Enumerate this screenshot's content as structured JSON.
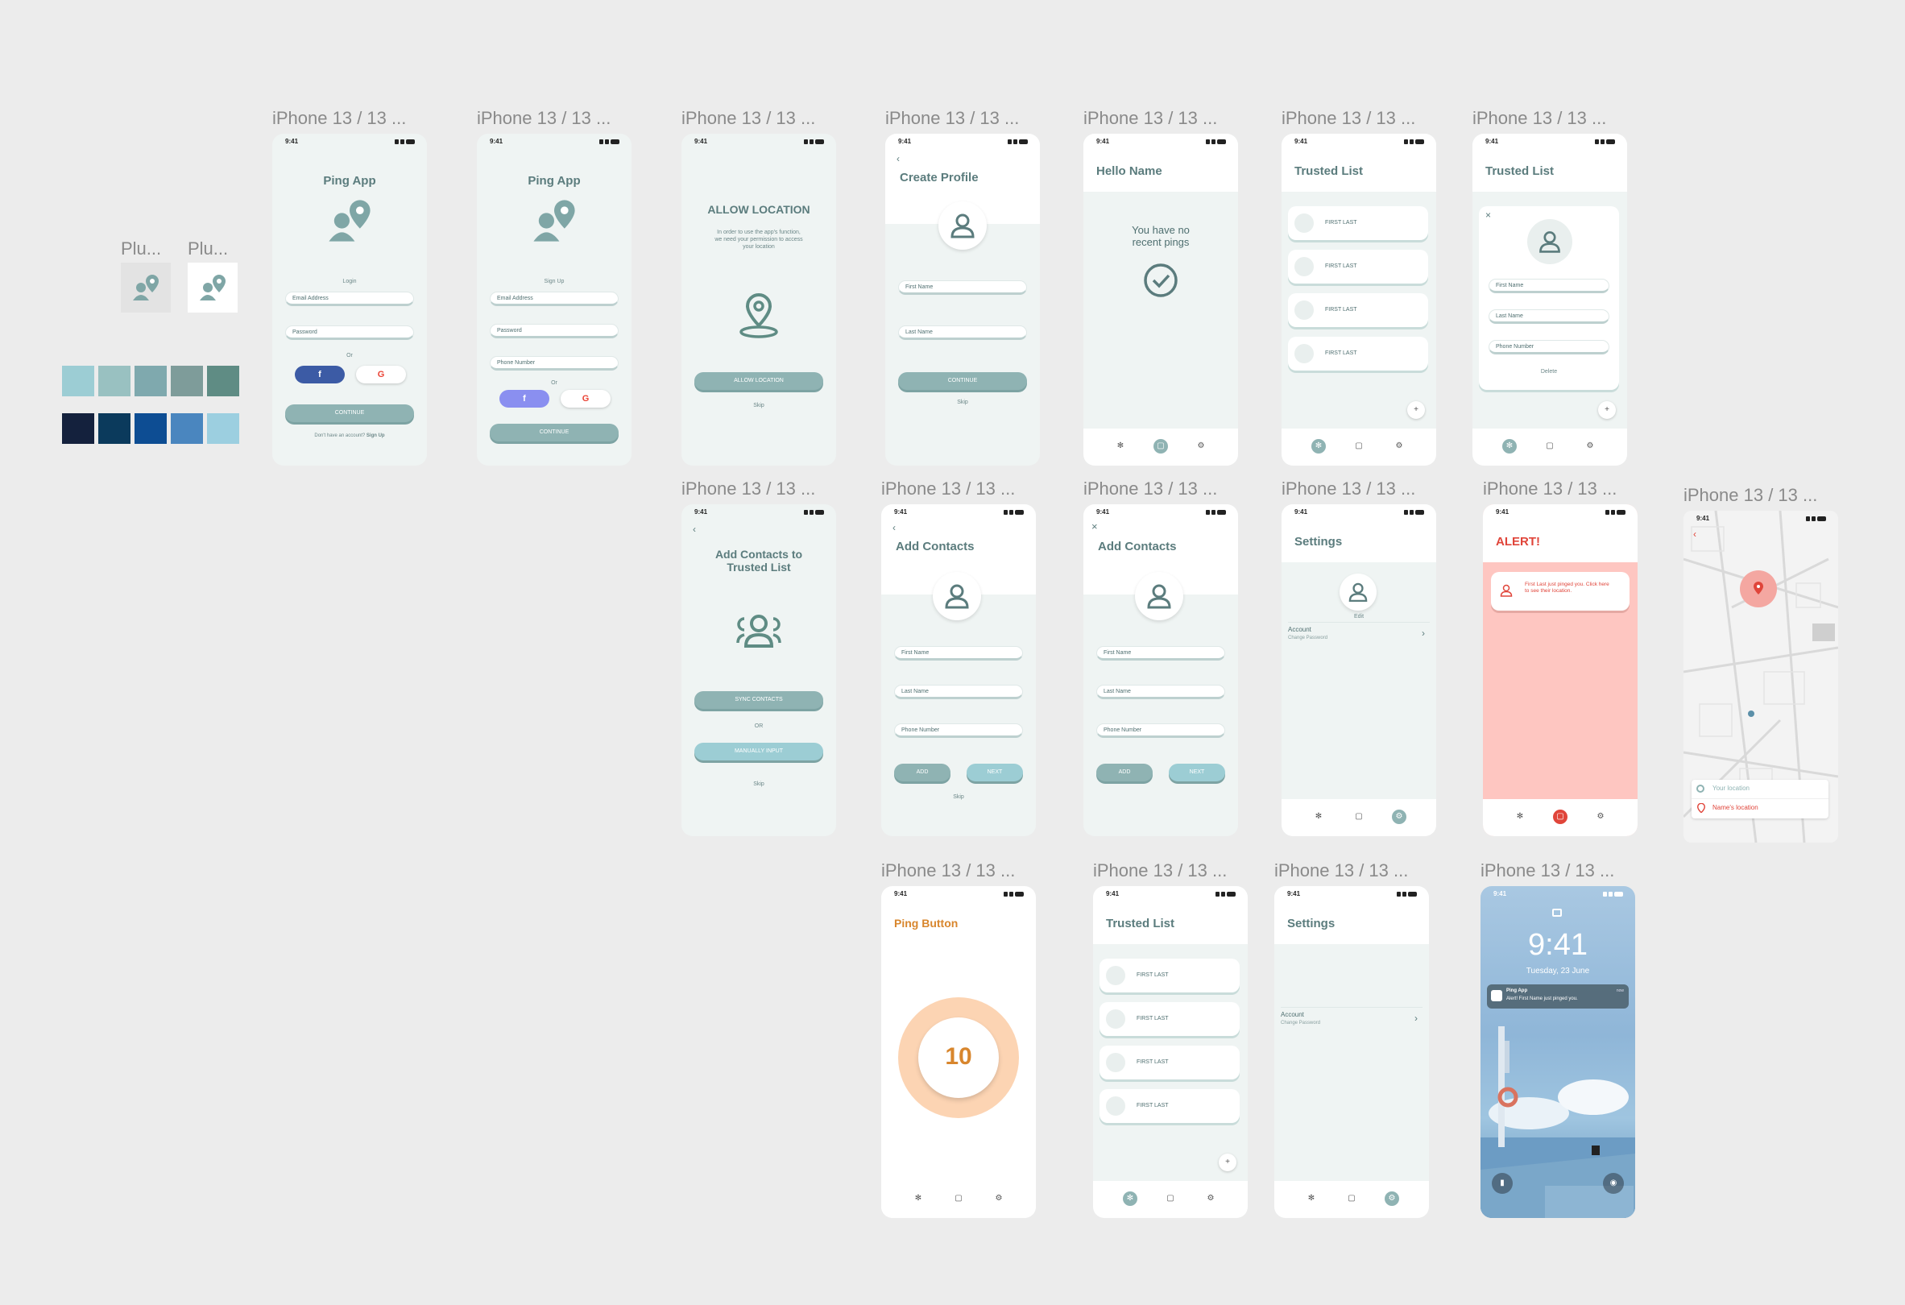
{
  "frame_label": "iPhone 13 / 13 ...",
  "plugin_label": "Plu...",
  "status_time": "9:41",
  "colors": {
    "palette_row1": [
      "#9ccdd4",
      "#99c1c1",
      "#7fa9ae",
      "#7e9c9a",
      "#5f8c84"
    ],
    "palette_row2": [
      "#14213d",
      "#0b3a5c",
      "#0d4d93",
      "#4a86bf",
      "#9ccfe0"
    ],
    "accent": "#8fb3b3",
    "alert": "#fec6c1",
    "orange": "#d8862d"
  },
  "login": {
    "title": "Ping App",
    "section": "Login",
    "email": "Email Address",
    "password": "Password",
    "or": "Or",
    "continue": "CONTINUE",
    "footer": "Don't have an account? ",
    "footer_link": "Sign Up"
  },
  "signup": {
    "title": "Ping App",
    "section": "Sign Up",
    "email": "Email Address",
    "password": "Password",
    "phone": "Phone Number",
    "or": "Or",
    "continue": "CONTINUE"
  },
  "allow": {
    "title": "ALLOW LOCATION",
    "body": "In order to use the app's function, we need your permission to access your location",
    "button": "ALLOW LOCATION",
    "skip": "Skip"
  },
  "create_profile": {
    "title": "Create Profile",
    "first": "First Name",
    "last": "Last Name",
    "continue": "CONTINUE",
    "skip": "Skip"
  },
  "hello": {
    "title": "Hello Name",
    "message": "You have no recent pings"
  },
  "trusted": {
    "title": "Trusted List",
    "items": [
      "FIRST LAST",
      "FIRST LAST",
      "FIRST LAST",
      "FIRST LAST"
    ]
  },
  "trusted_edit": {
    "title": "Trusted List",
    "first": "First Name",
    "last": "Last Name",
    "phone": "Phone Number",
    "delete": "Delete"
  },
  "add_contacts_trusted": {
    "title": "Add Contacts to Trusted List",
    "sync": "SYNC CONTACTS",
    "or": "OR",
    "manual": "MANUALLY INPUT",
    "skip": "Skip"
  },
  "add_contacts": {
    "title": "Add Contacts",
    "first": "First Name",
    "last": "Last Name",
    "phone": "Phone Number",
    "add": "ADD",
    "next": "NEXT",
    "skip": "Skip"
  },
  "settings": {
    "title": "Settings",
    "edit": "Edit",
    "account": "Account",
    "change": "Change Password"
  },
  "alert": {
    "title": "ALERT!",
    "message": "First Last just pinged you. Click here to see their location."
  },
  "map": {
    "your": "Your location",
    "names": "Name's location"
  },
  "ping": {
    "title": "Ping Button",
    "count": "10"
  },
  "lock": {
    "time": "9:41",
    "date": "Tuesday, 23 June",
    "app": "Ping App",
    "notif": "Alert! First Name just pinged you.",
    "when": "now"
  }
}
